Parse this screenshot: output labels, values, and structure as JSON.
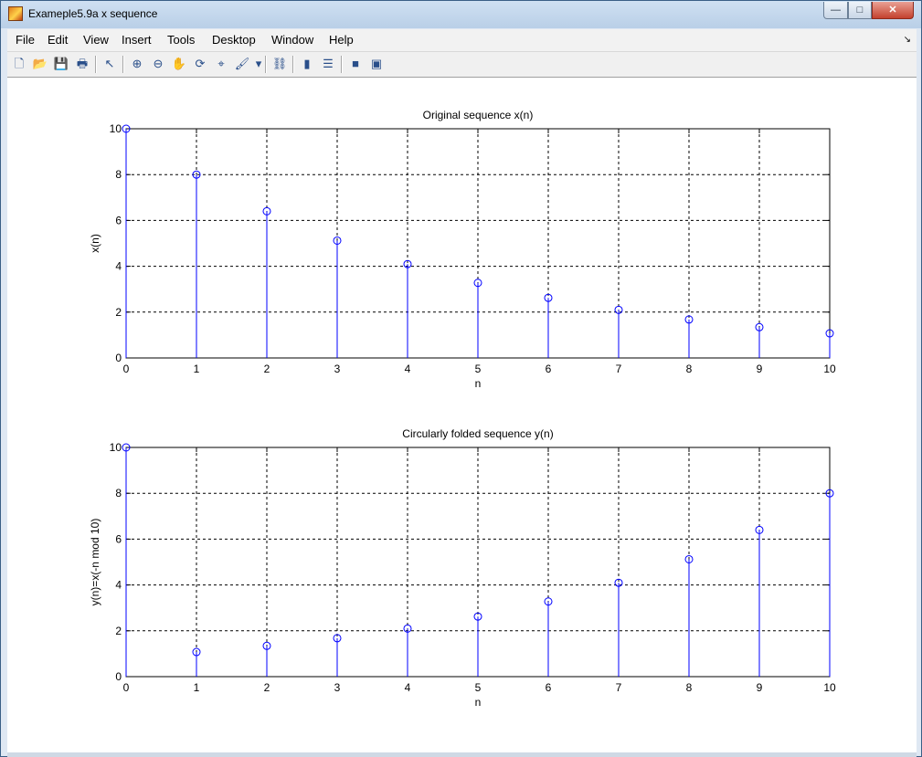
{
  "window": {
    "title": "Exameple5.9a x sequence"
  },
  "window_controls": {
    "minimize": "—",
    "maximize": "□",
    "close": "✕"
  },
  "menu": [
    "File",
    "Edit",
    "View",
    "Insert",
    "Tools",
    "Desktop",
    "Window",
    "Help"
  ],
  "menu_arrow": "↘",
  "toolbar": {
    "groups": [
      [
        {
          "name": "new-figure-icon",
          "glyph": "🗋"
        },
        {
          "name": "open-file-icon",
          "glyph": "📂"
        },
        {
          "name": "save-icon",
          "glyph": "💾"
        },
        {
          "name": "print-icon",
          "glyph": "🖶"
        }
      ],
      [
        {
          "name": "edit-plot-arrow-icon",
          "glyph": "↖"
        }
      ],
      [
        {
          "name": "zoom-in-icon",
          "glyph": "⊕"
        },
        {
          "name": "zoom-out-icon",
          "glyph": "⊖"
        },
        {
          "name": "pan-hand-icon",
          "glyph": "✋"
        },
        {
          "name": "rotate-3d-icon",
          "glyph": "⟳"
        },
        {
          "name": "data-cursor-icon",
          "glyph": "⌖"
        },
        {
          "name": "brush-icon",
          "glyph": "🖌"
        },
        {
          "name": "brush-dropdown-icon",
          "glyph": "▾"
        }
      ],
      [
        {
          "name": "link-plot-icon",
          "glyph": "⛓"
        }
      ],
      [
        {
          "name": "colorbar-icon",
          "glyph": "▮"
        },
        {
          "name": "legend-icon",
          "glyph": "☰"
        }
      ],
      [
        {
          "name": "hide-plot-tools-icon",
          "glyph": "■"
        },
        {
          "name": "show-plot-tools-icon",
          "glyph": "▣"
        }
      ]
    ]
  },
  "colors": {
    "stem": "#0000ff",
    "grid": "#000000",
    "axes": "#000000"
  },
  "chart_data": [
    {
      "type": "stem",
      "title": "Original sequence x(n)",
      "xlabel": "n",
      "ylabel": "x(n)",
      "x": [
        0,
        1,
        2,
        3,
        4,
        5,
        6,
        7,
        8,
        9,
        10
      ],
      "values": [
        10,
        8,
        6.4,
        5.12,
        4.096,
        3.2768,
        2.6214,
        2.0972,
        1.6777,
        1.3422,
        1.0737
      ],
      "xlim": [
        0,
        10
      ],
      "ylim": [
        0,
        10
      ],
      "xticks": [
        0,
        1,
        2,
        3,
        4,
        5,
        6,
        7,
        8,
        9,
        10
      ],
      "yticks": [
        0,
        2,
        4,
        6,
        8,
        10
      ],
      "grid": true,
      "marker": "circle"
    },
    {
      "type": "stem",
      "title": "Circularly folded sequence y(n)",
      "xlabel": "n",
      "ylabel": "y(n)=x(-n mod 10)",
      "x": [
        0,
        1,
        2,
        3,
        4,
        5,
        6,
        7,
        8,
        9,
        10
      ],
      "values": [
        10,
        1.0737,
        1.3422,
        1.6777,
        2.0972,
        2.6214,
        3.2768,
        4.096,
        5.12,
        6.4,
        8
      ],
      "xlim": [
        0,
        10
      ],
      "ylim": [
        0,
        10
      ],
      "xticks": [
        0,
        1,
        2,
        3,
        4,
        5,
        6,
        7,
        8,
        9,
        10
      ],
      "yticks": [
        0,
        2,
        4,
        6,
        8,
        10
      ],
      "grid": true,
      "marker": "circle"
    }
  ]
}
